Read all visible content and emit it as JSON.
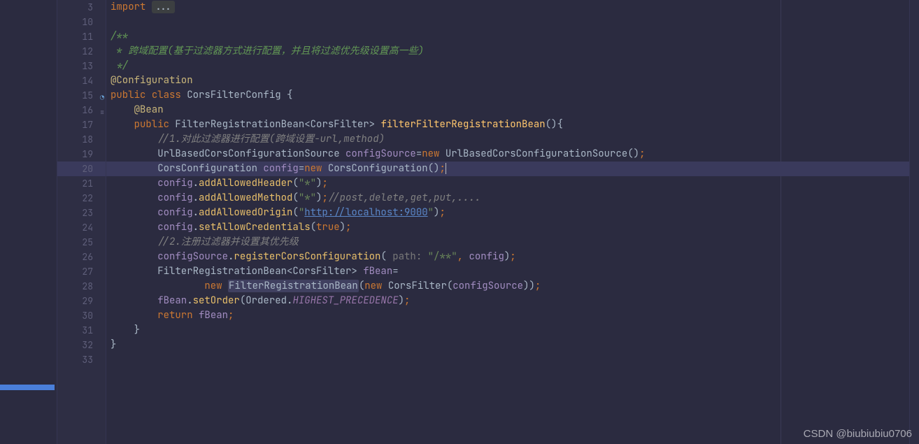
{
  "gutter": {
    "start": 3,
    "end": 33,
    "current": 20,
    "icons": {
      "15": "impl",
      "16": "link"
    }
  },
  "code": {
    "l3": {
      "kw": "import",
      "fold": "..."
    },
    "l11": {
      "a": "/**"
    },
    "l12": {
      "a": " * 跨域配置(基于过滤器方式进行配置，并且将过滤优先级设置高一些)"
    },
    "l13": {
      "a": " */"
    },
    "l14": {
      "a": "@Configuration"
    },
    "l15": {
      "kw1": "public ",
      "kw2": "class ",
      "name": "CorsFilterConfig ",
      "brace": "{"
    },
    "l16": {
      "a": "@Bean"
    },
    "l17": {
      "kw": "public ",
      "type1": "FilterRegistrationBean",
      "lt": "<",
      "type2": "CorsFilter",
      "gt": "> ",
      "name": "filterFilterRegistrationBean",
      "paren": "()",
      "brace": "{"
    },
    "l18": {
      "a": "//1.对此过滤器进行配置(跨域设置-url,method)"
    },
    "l19": {
      "type": "UrlBasedCorsConfigurationSource ",
      "var": "configSource",
      "eq": "=",
      "kw": "new ",
      "type2": "UrlBasedCorsConfigurationSource",
      "paren": "()",
      "semi": ";"
    },
    "l20": {
      "type": "CorsConfiguration ",
      "var": "config",
      "eq": "=",
      "kw": "new ",
      "type2": "CorsConfiguration",
      "paren": "()",
      "semi": ";"
    },
    "l21": {
      "var": "config",
      "dot": ".",
      "m": "addAllowedHeader",
      "open": "(",
      "str": "\"*\"",
      "close": ")",
      "semi": ";"
    },
    "l22": {
      "var": "config",
      "dot": ".",
      "m": "addAllowedMethod",
      "open": "(",
      "str": "\"*\"",
      "close": ")",
      "semi": ";",
      "cmt": "//post,delete,get,put,...."
    },
    "l23": {
      "var": "config",
      "dot": ".",
      "m": "addAllowedOrigin",
      "open": "(",
      "q1": "\"",
      "url": "http://localhost:9000",
      "q2": "\"",
      "close": ")",
      "semi": ";"
    },
    "l24": {
      "var": "config",
      "dot": ".",
      "m": "setAllowCredentials",
      "open": "(",
      "val": "true",
      "close": ")",
      "semi": ";"
    },
    "l25": {
      "a": "//2.注册过滤器并设置其优先级"
    },
    "l26": {
      "var": "configSource",
      "dot": ".",
      "m": "registerCorsConfiguration",
      "open": "(",
      "hint": " path: ",
      "str": "\"/**\"",
      "comma": ", ",
      "arg": "config",
      "close": ")",
      "semi": ";"
    },
    "l27": {
      "type1": "FilterRegistrationBean",
      "lt": "<",
      "type2": "CorsFilter",
      "gt": "> ",
      "var": "fBean",
      "eq": "="
    },
    "l28": {
      "kw1": "new ",
      "hl": "FilterRegistrationBean",
      "open": "(",
      "kw2": "new ",
      "type": "CorsFilter",
      "open2": "(",
      "arg": "configSource",
      "close2": ")",
      "close": ")",
      "semi": ";"
    },
    "l29": {
      "var": "fBean",
      "dot": ".",
      "m": "setOrder",
      "open": "(",
      "cls": "Ordered",
      "dot2": ".",
      "const": "HIGHEST_PRECEDENCE",
      "close": ")",
      "semi": ";"
    },
    "l30": {
      "kw": "return ",
      "var": "fBean",
      "semi": ";"
    },
    "l31": {
      "a": "}"
    },
    "l32": {
      "a": "}"
    }
  },
  "watermark": "CSDN @biubiubiu0706"
}
